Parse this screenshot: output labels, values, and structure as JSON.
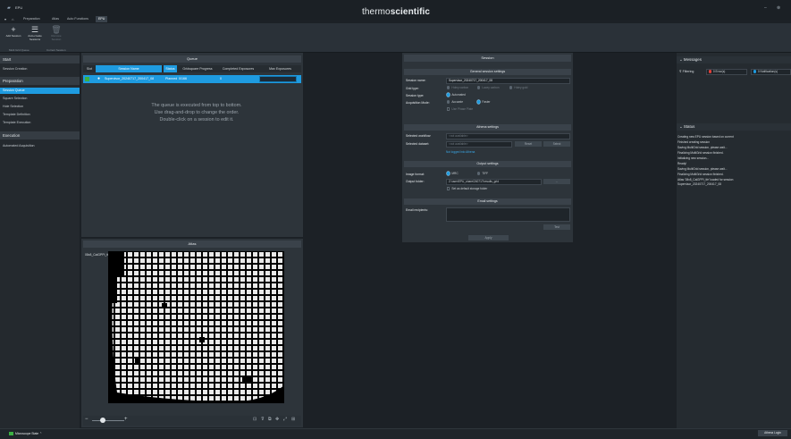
{
  "app": {
    "title": "EPU",
    "brand_light": "thermo",
    "brand_bold": "scientific"
  },
  "window": {
    "minimize": "–",
    "close": "⊗"
  },
  "ribbon": {
    "tabs": [
      "Preparation",
      "Atlas",
      "Auto Functions",
      "EPU"
    ],
    "buttons": [
      {
        "label": "Add Session",
        "icon": "plus-icon"
      },
      {
        "label": "Auto-create Sessions",
        "icon": "list-icon"
      },
      {
        "label": "Remove Session",
        "icon": "trash-icon"
      }
    ],
    "groups": [
      "Multi Grid Queue",
      "Current Session"
    ]
  },
  "nav": {
    "sections": [
      {
        "title": "Start",
        "items": [
          "Session Creation"
        ]
      },
      {
        "title": "Preparation",
        "items": [
          "Session Queue",
          "Square Selection",
          "Hole Selection",
          "Template Definition",
          "Template Execution"
        ]
      },
      {
        "title": "Execution",
        "items": [
          "Automated Acquisition"
        ]
      }
    ],
    "active": "Session Queue"
  },
  "queue": {
    "title": "Queue",
    "columns": [
      "Slot",
      "Session Name",
      "Status",
      "Gridsquare Progress",
      "Completed Exposures",
      "Max Exposures"
    ],
    "rows": [
      {
        "slot": "",
        "name": "Supervisor_20240717_200417_08",
        "status": "Planned",
        "progress": "0/166",
        "completed": "0",
        "max": ""
      }
    ],
    "message": [
      "The queue is executed from top to bottom.",
      "Use drag-and-drop to change the order.",
      "Double-click on a session to edit it."
    ]
  },
  "atlas": {
    "title": "Atlas",
    "name": "08x8_CalGPPI_tfe"
  },
  "session": {
    "title": "Session",
    "general": {
      "title": "General session settings",
      "name_label": "Session name:",
      "name_value": "Supervisor_20240717_200417_08",
      "grid_label": "Grid type:",
      "grid_options": [
        "Holey carbon",
        "Lacey carbon",
        "Holey gold"
      ],
      "type_label": "Session type:",
      "type_value": "Automated",
      "mode_label": "Acquisition Mode:",
      "mode_options": [
        "Accurate",
        "Faster"
      ],
      "phase_plate": "Use Phase Plate"
    },
    "athena": {
      "title": "Athena settings",
      "workflow_label": "Selected workflow:",
      "workflow_value": "<not available>",
      "dataset_label": "Selected dataset:",
      "dataset_value": "<not available>",
      "reset": "Reset",
      "select": "Select",
      "login_link": "Not logged into Athena"
    },
    "output": {
      "title": "Output settings",
      "format_label": "Image format:",
      "format_options": [
        "MRC",
        "TIFF"
      ],
      "folder_label": "Output folder:",
      "folder_value": "Z:\\user\\EPU_share\\240717\\results_grid",
      "browse": "...",
      "default_storage": "Set as default storage folder"
    },
    "email": {
      "title": "Email settings",
      "recipients_label": "Email recipients:",
      "test": "Test"
    },
    "apply": "Apply"
  },
  "messages": {
    "title": "Messages",
    "filter_label": "Filtering",
    "errors": "0 Error(s)",
    "notifications": "0 Notification(s)",
    "error_color": "#e0403a",
    "notification_color": "#1e9be0"
  },
  "status": {
    "title": "Status",
    "lines": [
      "Creating new EPU session based on current",
      "Finished creating session",
      "Saving MultiGrid session, please wait...",
      "Finalizing MultiGrid session finished.",
      "Initializing new session...",
      "Ready!",
      "Saving MultiGrid session, please wait...",
      "Finalizing MultiGrid session finished.",
      "Atlas '08x8_CalGPPI_tfe' loaded for session",
      "Supervisor_20240717_200417_08"
    ]
  },
  "statusbar": {
    "microscope_state": "Microscope State",
    "athena_login": "Athena Login",
    "led_color": "#3cb043"
  }
}
